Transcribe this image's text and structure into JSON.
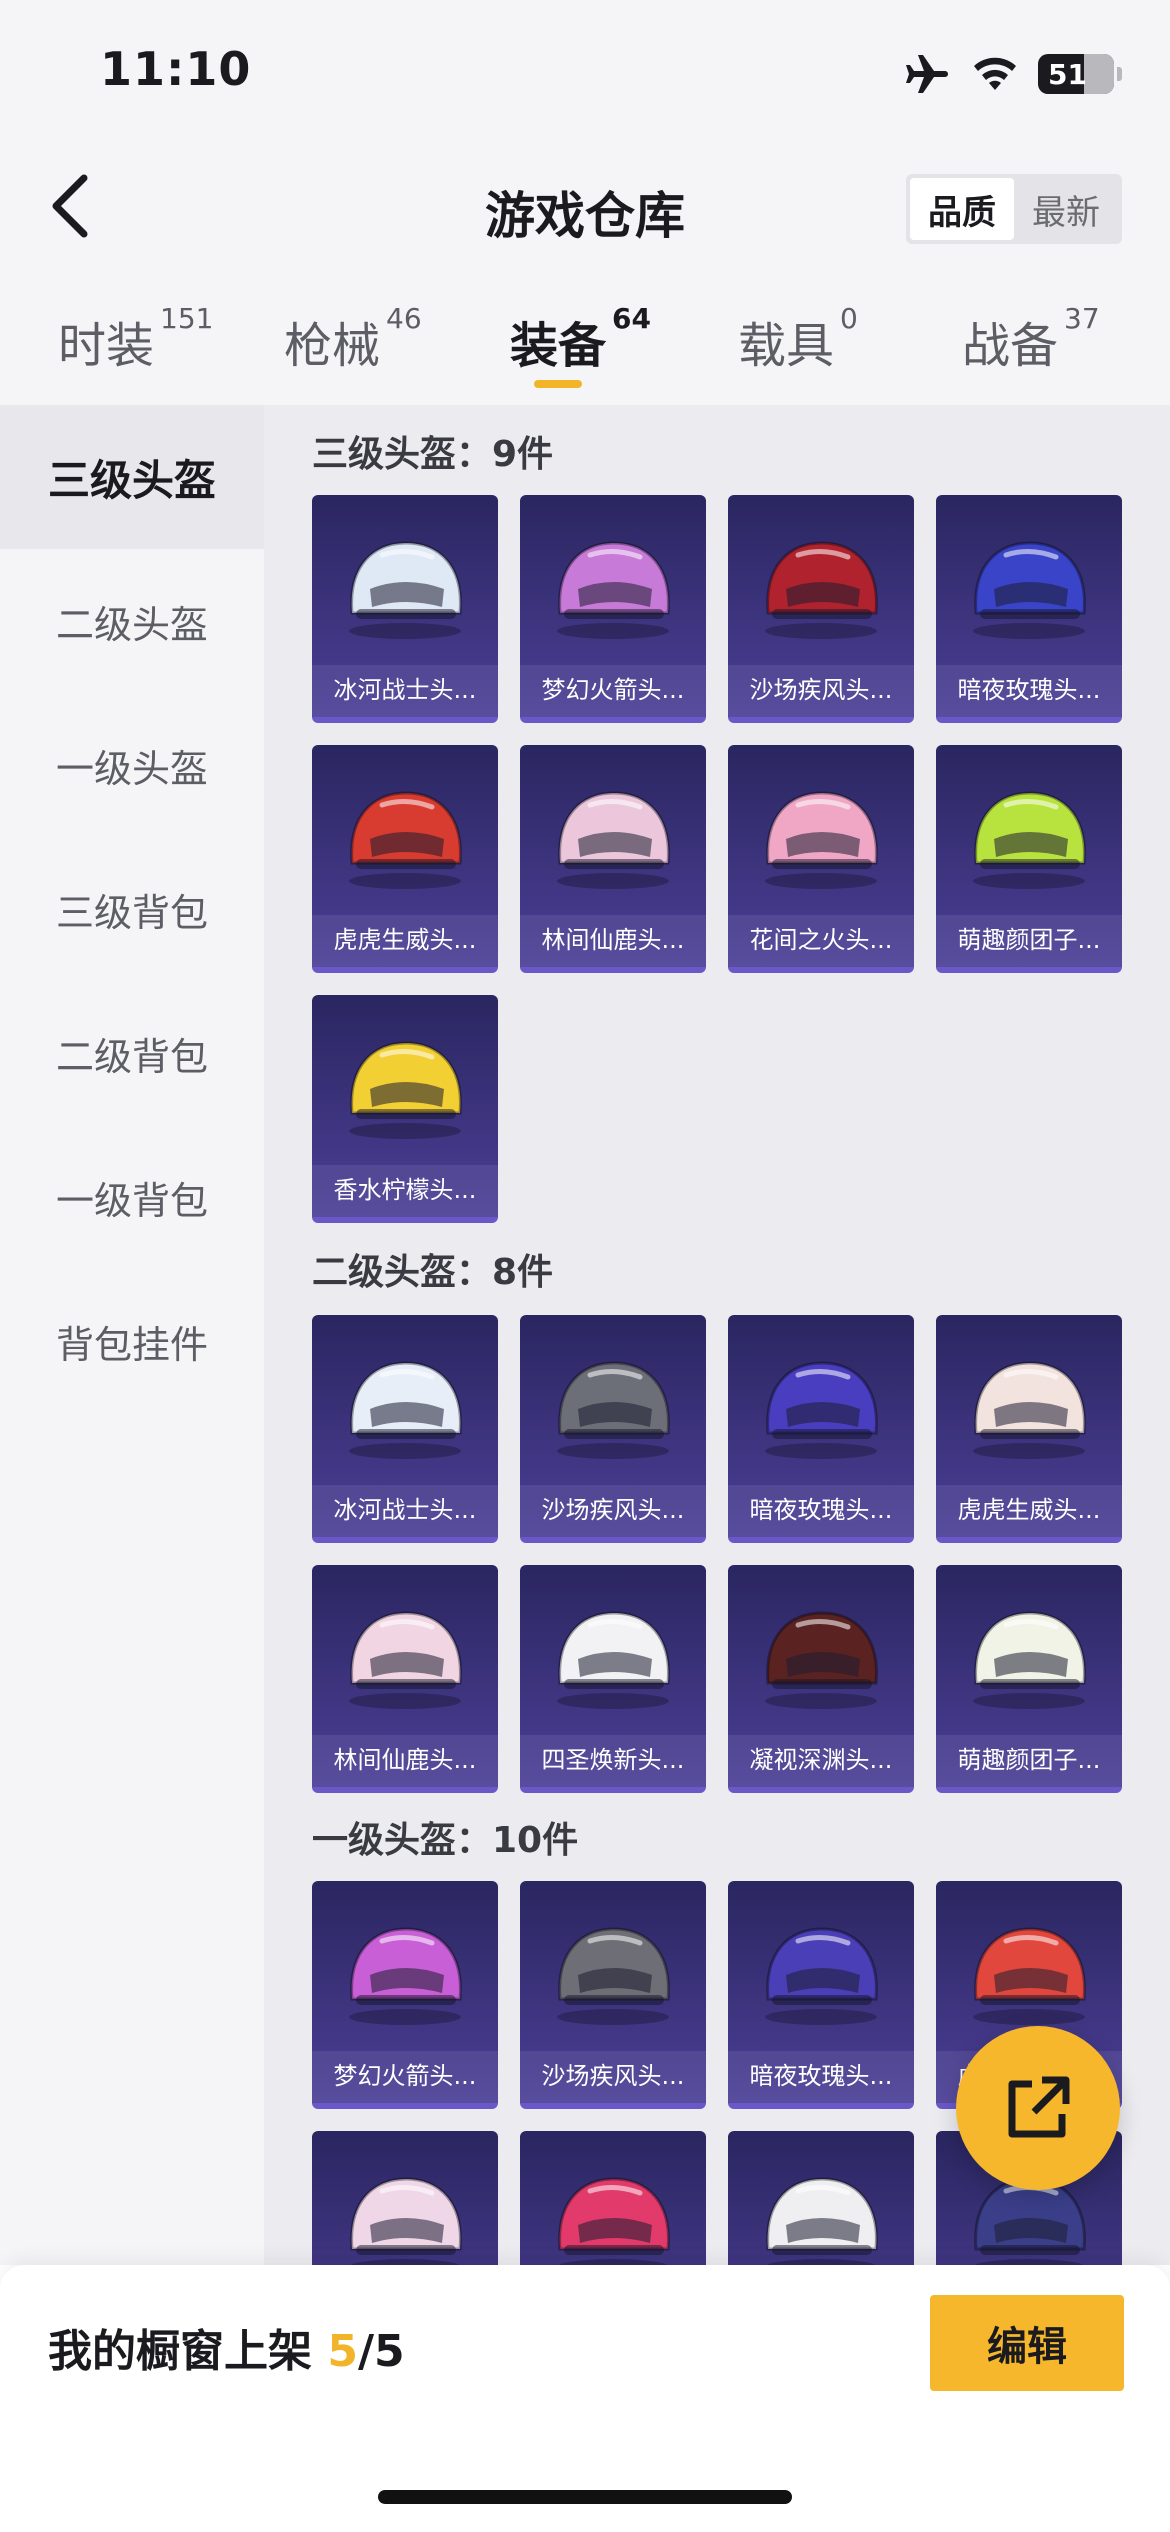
{
  "status_bar": {
    "time": "11:10",
    "battery": "51"
  },
  "header": {
    "title": "游戏仓库",
    "sort_options": [
      "品质",
      "最新"
    ],
    "active_sort": "品质"
  },
  "tabs": [
    {
      "label": "时装",
      "count": "151"
    },
    {
      "label": "枪械",
      "count": "46"
    },
    {
      "label": "装备",
      "count": "64"
    },
    {
      "label": "载具",
      "count": "0"
    },
    {
      "label": "战备",
      "count": "37"
    }
  ],
  "sidebar": {
    "items": [
      "三级头盔",
      "二级头盔",
      "一级头盔",
      "三级背包",
      "二级背包",
      "一级背包",
      "背包挂件"
    ]
  },
  "sections": [
    {
      "title": "三级头盔：9件",
      "items": [
        {
          "name": "冰河战士头...",
          "color": "#dfe8f5"
        },
        {
          "name": "梦幻火箭头...",
          "color": "#c77ad8"
        },
        {
          "name": "沙场疾风头...",
          "color": "#b0232e"
        },
        {
          "name": "暗夜玫瑰头...",
          "color": "#3a44c8"
        },
        {
          "name": "虎虎生威头...",
          "color": "#d83b2f"
        },
        {
          "name": "林间仙鹿头...",
          "color": "#ecc7dc"
        },
        {
          "name": "花间之火头...",
          "color": "#f0a7c6"
        },
        {
          "name": "萌趣颜团子...",
          "color": "#b8e23e"
        },
        {
          "name": "香水柠檬头...",
          "color": "#f2cf33"
        }
      ]
    },
    {
      "title": "二级头盔：8件",
      "items": [
        {
          "name": "冰河战士头...",
          "color": "#e7eef8"
        },
        {
          "name": "沙场疾风头...",
          "color": "#6d6f78"
        },
        {
          "name": "暗夜玫瑰头...",
          "color": "#4a3ec0"
        },
        {
          "name": "虎虎生威头...",
          "color": "#f3e3df"
        },
        {
          "name": "林间仙鹿头...",
          "color": "#f1d5e3"
        },
        {
          "name": "四圣焕新头...",
          "color": "#f2f2f4"
        },
        {
          "name": "凝视深渊头...",
          "color": "#5b2222"
        },
        {
          "name": "萌趣颜团子...",
          "color": "#f1f3e6"
        }
      ]
    },
    {
      "title": "一级头盔：10件",
      "items": [
        {
          "name": "梦幻火箭头...",
          "color": "#c85fd6"
        },
        {
          "name": "沙场疾风头...",
          "color": "#6e6e76"
        },
        {
          "name": "暗夜玫瑰头...",
          "color": "#4b3fb8"
        },
        {
          "name": "虎虎生威头...",
          "color": "#e2473d"
        },
        {
          "name": "",
          "color": "#f0d7e8"
        },
        {
          "name": "",
          "color": "#e23a6b"
        },
        {
          "name": "",
          "color": "#efeff2"
        },
        {
          "name": "",
          "color": "#3b3f8a"
        }
      ]
    }
  ],
  "bottom_bar": {
    "label": "我的橱窗上架",
    "count_current": "5",
    "count_total": "/5",
    "edit_label": "编辑"
  },
  "icons": {
    "back": "chevron-left-icon",
    "fab": "share-icon"
  },
  "accent": "#f6b72d"
}
